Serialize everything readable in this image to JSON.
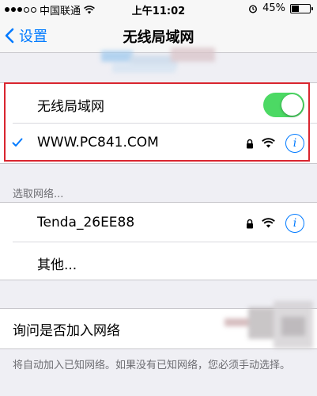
{
  "status_bar": {
    "carrier": "中国联通",
    "time": "上午11:02",
    "battery_percent": "45%",
    "battery_level": 0.45,
    "icons": [
      "signal-dots",
      "wifi-icon",
      "alarm-icon",
      "battery-icon"
    ]
  },
  "nav": {
    "back_label": "设置",
    "title": "无线局域网"
  },
  "wifi_toggle": {
    "label": "无线局域网",
    "on": true,
    "color": "#4cd964"
  },
  "connected_network": {
    "name": "WWW.PC841.COM",
    "selected": true,
    "secured": true,
    "info_symbol": "i"
  },
  "choose_network": {
    "header": "选取网络...",
    "networks": [
      {
        "name": "Tenda_26EE88",
        "secured": true,
        "info_symbol": "i"
      }
    ],
    "other_label": "其他..."
  },
  "ask_to_join": {
    "label": "询问是否加入网络",
    "footer": "将自动加入已知网络。如果没有已知网络，您必须手动选择。"
  },
  "colors": {
    "accent": "#007aff",
    "highlight_box": "#d9252f",
    "background": "#efeff4"
  }
}
